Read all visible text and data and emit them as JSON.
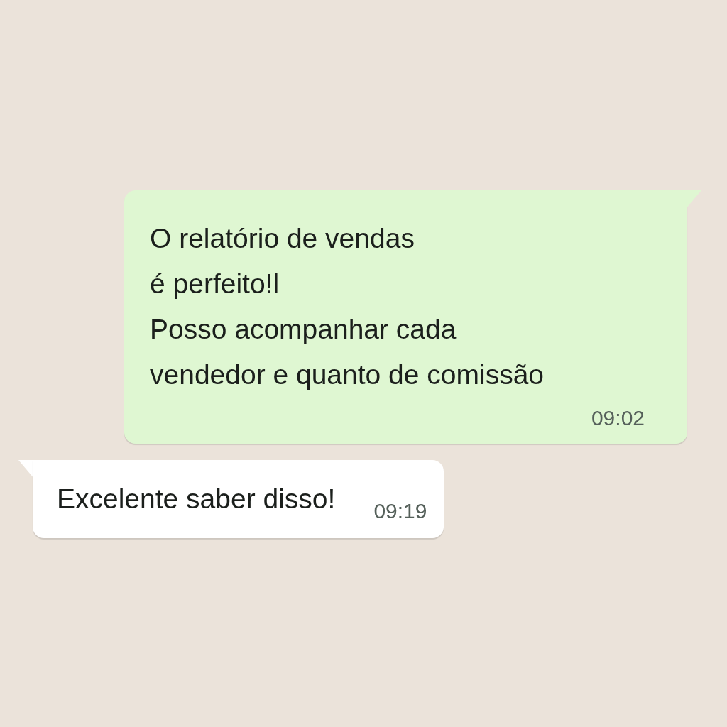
{
  "messages": [
    {
      "kind": "outgoing",
      "lines": [
        "O relatório de vendas",
        "é perfeito!l",
        "Posso acompanhar cada",
        "vendedor e quanto de comissão"
      ],
      "time": "09:02"
    },
    {
      "kind": "incoming",
      "lines": [
        "Excelente saber disso!"
      ],
      "time": "09:19"
    }
  ]
}
